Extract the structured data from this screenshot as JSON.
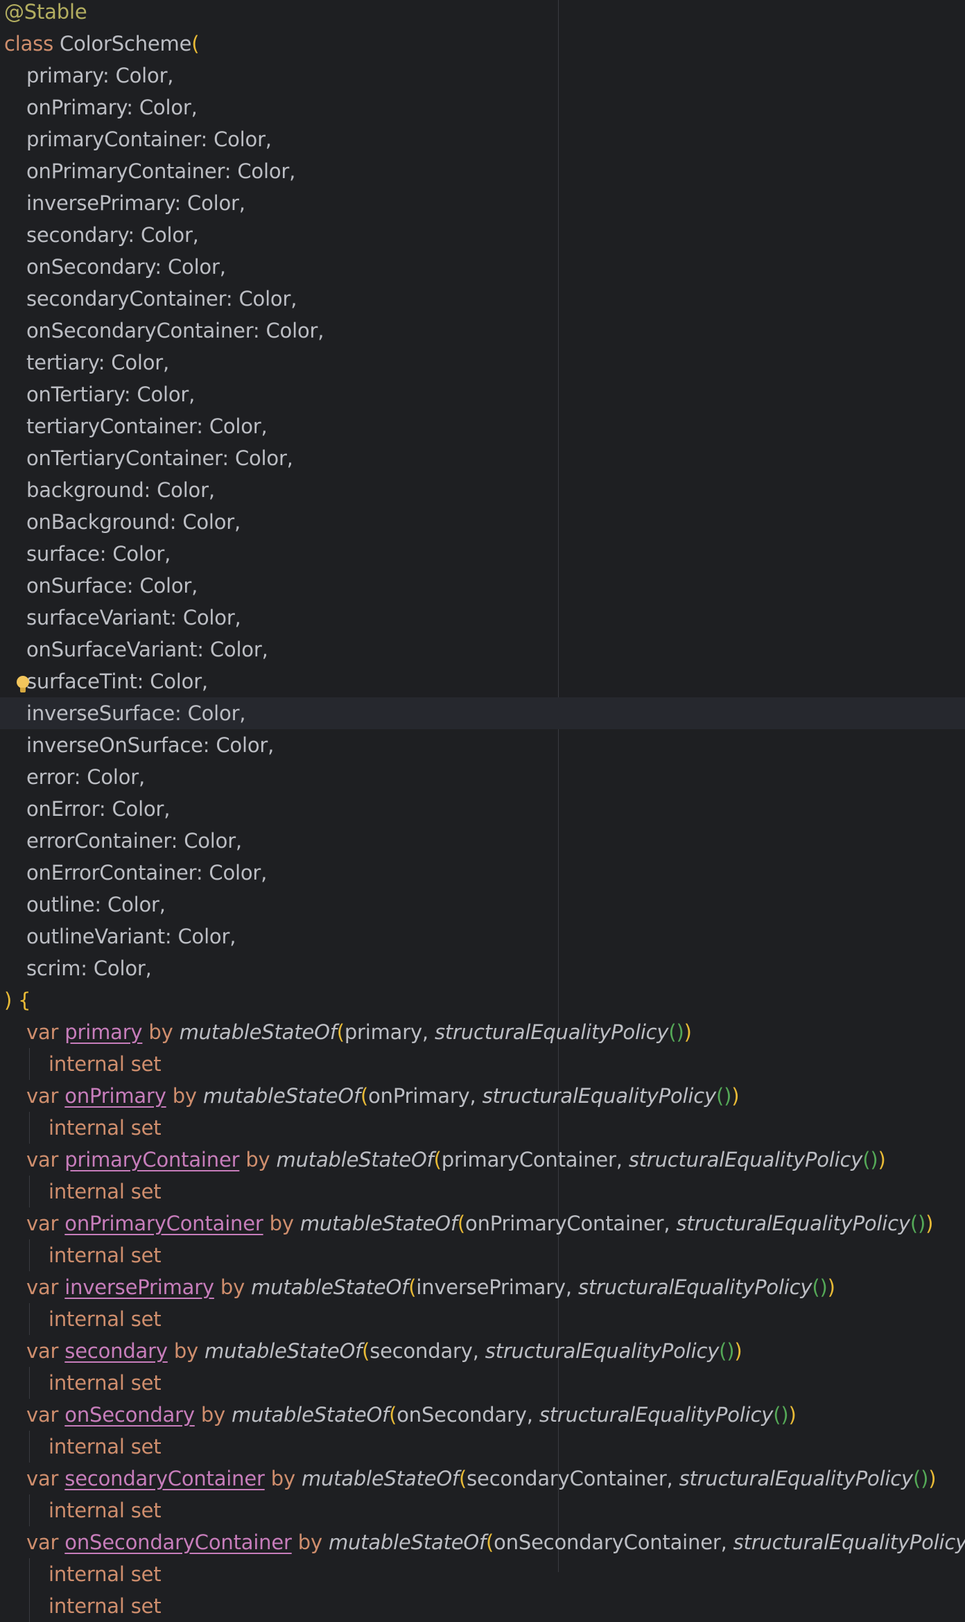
{
  "editor": {
    "header": {
      "annotation": "@Stable",
      "class_keyword": "class",
      "class_name": "ColorScheme",
      "open_paren": "("
    },
    "params": [
      "primary: Color,",
      "onPrimary: Color,",
      "primaryContainer: Color,",
      "onPrimaryContainer: Color,",
      "inversePrimary: Color,",
      "secondary: Color,",
      "onSecondary: Color,",
      "secondaryContainer: Color,",
      "onSecondaryContainer: Color,",
      "tertiary: Color,",
      "onTertiary: Color,",
      "tertiaryContainer: Color,",
      "onTertiaryContainer: Color,",
      "background: Color,",
      "onBackground: Color,",
      "surface: Color,",
      "onSurface: Color,",
      "surfaceVariant: Color,",
      "onSurfaceVariant: Color,",
      "surfaceTint: Color,",
      "inverseSurface: Color,",
      "inverseOnSurface: Color,",
      "error: Color,",
      "onError: Color,",
      "errorContainer: Color,",
      "onErrorContainer: Color,",
      "outline: Color,",
      "outlineVariant: Color,",
      "scrim: Color,"
    ],
    "body_open_paren": ")",
    "body_open_brace": " {",
    "keywords": {
      "var": "var",
      "by": "by",
      "internal_set": "internal set"
    },
    "fn_state": "mutableStateOf",
    "fn_policy": "structuralEqualityPolicy",
    "tokens": {
      "open_paren": "(",
      "arg_sep": ", ",
      "empty_call": "()",
      "close_paren": ")"
    },
    "props": [
      {
        "name": "primary",
        "arg": "primary",
        "setter": true
      },
      {
        "name": "onPrimary",
        "arg": "onPrimary",
        "setter": true
      },
      {
        "name": "primaryContainer",
        "arg": "primaryContainer",
        "setter": true
      },
      {
        "name": "onPrimaryContainer",
        "arg": "onPrimaryContainer",
        "setter": true
      },
      {
        "name": "inversePrimary",
        "arg": "inversePrimary",
        "setter": true
      },
      {
        "name": "secondary",
        "arg": "secondary",
        "setter": true
      },
      {
        "name": "onSecondary",
        "arg": "onSecondary",
        "setter": true
      },
      {
        "name": "secondaryContainer",
        "arg": "secondaryContainer",
        "setter": true
      },
      {
        "name": "onSecondaryContainer",
        "arg": "onSecondaryContainer",
        "setter": true
      }
    ],
    "trailing_partial": "internal set",
    "colors": {
      "background": "#1e1f22",
      "caret_row": "#26282e",
      "text": "#bcbec4",
      "keyword": "#cf8e6d",
      "annotation": "#b3ae60",
      "property": "#c77dbb",
      "bracket_outer": "#e8ba36",
      "bracket_inner": "#54a857",
      "intention_bulb": "#f2c55c"
    },
    "icons": {
      "intention_action": "lightbulb-icon"
    }
  }
}
